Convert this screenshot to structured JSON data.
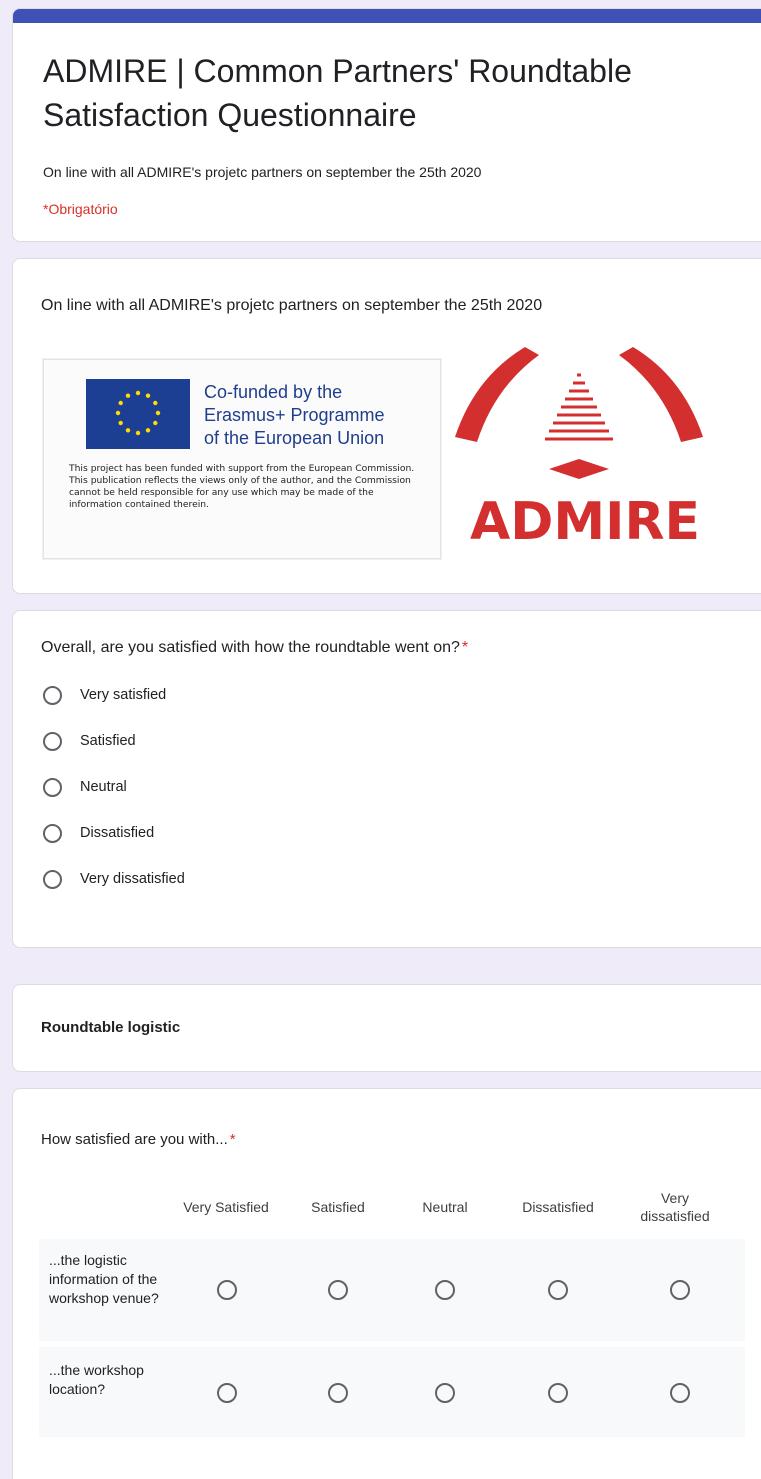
{
  "header": {
    "title": "ADMIRE | Common Partners' Roundtable Satisfaction Questionnaire",
    "description": "On line with all ADMIRE's projetc partners on september the 25th 2020",
    "required_note": "*Obrigatório",
    "accent_color": "#3f51b5"
  },
  "media_section": {
    "description": "On line with all ADMIRE's projetc partners on september the 25th 2020",
    "eu_logo": {
      "line1": "Co-funded by the",
      "line2": "Erasmus+ Programme",
      "line3": "of the European Union",
      "disclaimer": "This project has been funded with support from the European Commission. This publication reflects the views only of the author, and the Commission cannot be held responsible for any use which may be made of the information contained therein."
    },
    "admire_logo": {
      "text": "ADMIRE",
      "color": "#d32f2f"
    }
  },
  "question1": {
    "text": "Overall, are you satisfied with how the roundtable went on?",
    "required_mark": "*",
    "options": [
      "Very satisfied",
      "Satisfied",
      "Neutral",
      "Dissatisfied",
      "Very dissatisfied"
    ]
  },
  "section": {
    "title": "Roundtable logistic"
  },
  "grid_question": {
    "text": "How satisfied are you with...",
    "required_mark": "*",
    "columns": [
      "Very Satisfied",
      "Satisfied",
      "Neutral",
      "Dissatisfied",
      "Very dissatisfied"
    ],
    "rows": [
      "...the logistic information of the workshop venue?",
      "...the workshop location?"
    ]
  }
}
